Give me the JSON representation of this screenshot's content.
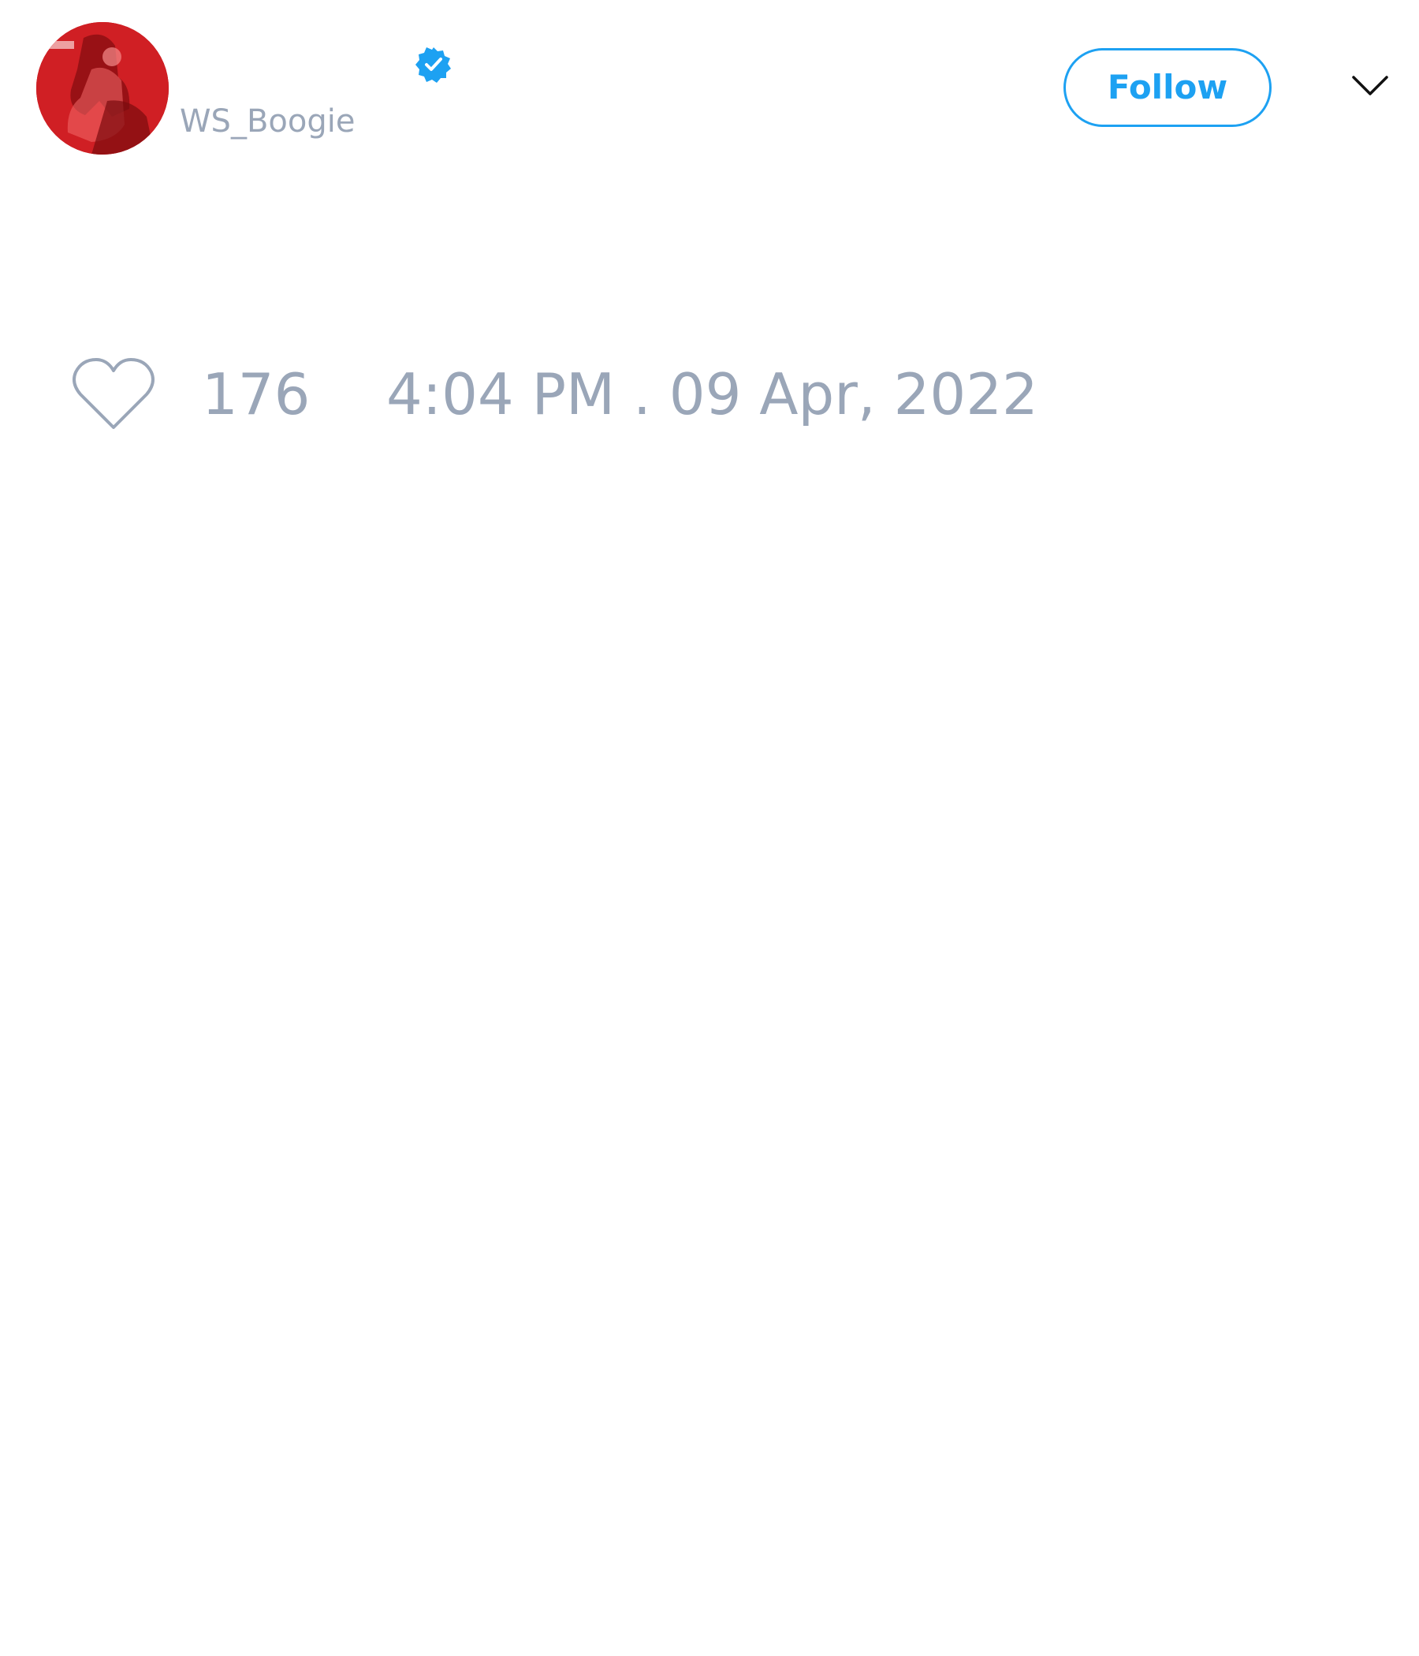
{
  "tweet": {
    "author": {
      "display_name": "",
      "handle": "WS_Boogie",
      "verified": true
    },
    "follow_label": "Follow",
    "like_count": "176",
    "timestamp": "4:04 PM . 09 Apr, 2022"
  },
  "icons": {
    "verified": "verified-badge-icon",
    "menu": "chevron-down-icon",
    "like": "heart-outline-icon"
  },
  "colors": {
    "accent": "#1da1f2",
    "muted_text": "#9aa6b8",
    "avatar_red": "#c2161c",
    "background": "#ffffff"
  }
}
